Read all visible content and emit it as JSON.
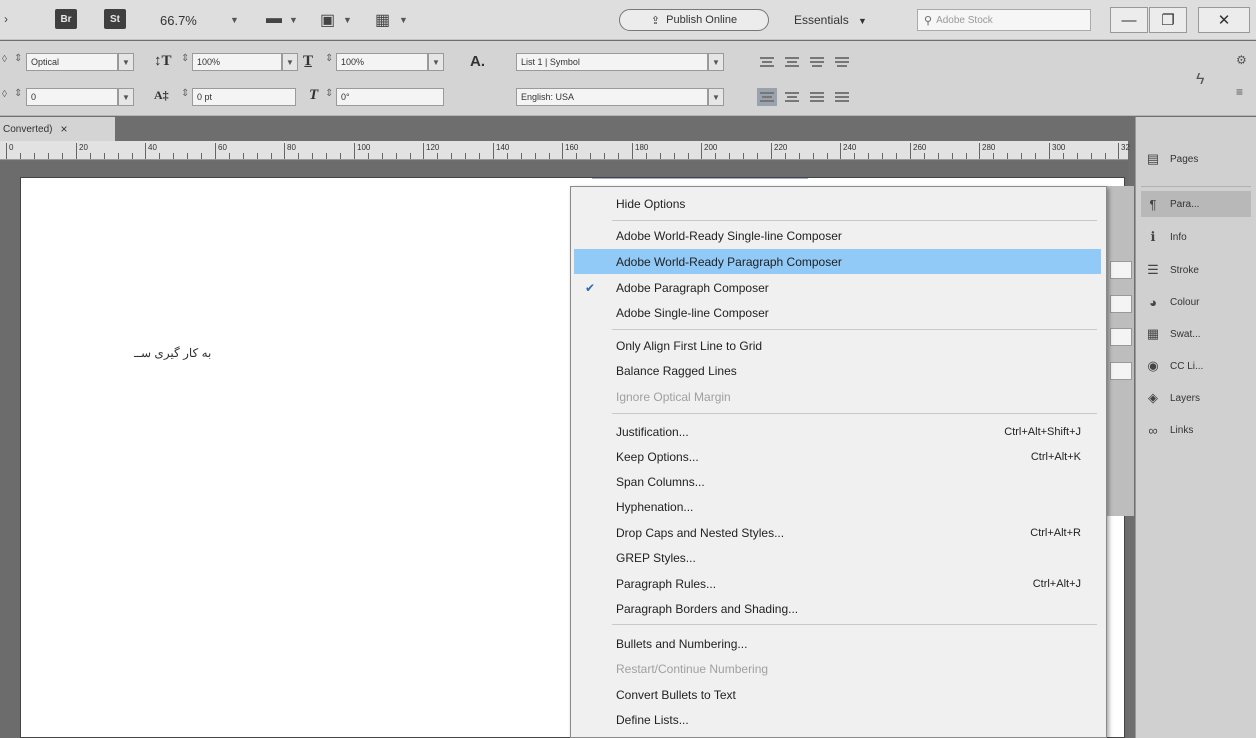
{
  "appbar": {
    "br_badge": "Br",
    "st_badge": "St",
    "zoom": "66.7%",
    "publish_label": "Publish Online",
    "workspace_label": "Essentials",
    "stock_placeholder": "Adobe Stock",
    "window_buttons": [
      "—",
      "❐",
      "✕"
    ]
  },
  "control_bar": {
    "kerning_value": "Optical",
    "tracking_value": "0",
    "vscale_value": "100%",
    "baseline_value": "0 pt",
    "hscale_value": "100%",
    "skew_value": "0°",
    "list_style": "List 1 | Symbol",
    "language": "English: USA"
  },
  "document": {
    "tab_title": "Converted)",
    "tab_close": "×",
    "page_text": "به کار گیری ســ",
    "ruler_labels": [
      "0",
      "20",
      "40",
      "60",
      "80",
      "100",
      "120",
      "140",
      "160",
      "180",
      "200",
      "220",
      "240",
      "260",
      "280",
      "300",
      "32"
    ]
  },
  "dock": {
    "items": [
      {
        "label": "Pages",
        "icon": "pages-icon"
      },
      {
        "label": "Para...",
        "icon": "paragraph-icon"
      },
      {
        "label": "Info",
        "icon": "info-icon"
      },
      {
        "label": "Stroke",
        "icon": "stroke-icon"
      },
      {
        "label": "Colour",
        "icon": "colour-icon"
      },
      {
        "label": "Swat...",
        "icon": "swatches-icon"
      },
      {
        "label": "CC Li...",
        "icon": "cc-libraries-icon"
      },
      {
        "label": "Layers",
        "icon": "layers-icon"
      },
      {
        "label": "Links",
        "icon": "links-icon"
      }
    ]
  },
  "menu": {
    "items": [
      {
        "label": "Hide Options",
        "shortcut": ""
      },
      {
        "label": "Adobe World-Ready Single-line Composer",
        "shortcut": ""
      },
      {
        "label": "Adobe World-Ready Paragraph Composer",
        "shortcut": "",
        "highlighted": true
      },
      {
        "label": "Adobe Paragraph Composer",
        "shortcut": "",
        "checked": true
      },
      {
        "label": "Adobe Single-line Composer",
        "shortcut": ""
      },
      {
        "label": "Only Align First Line to Grid",
        "shortcut": ""
      },
      {
        "label": "Balance Ragged Lines",
        "shortcut": ""
      },
      {
        "label": "Ignore Optical Margin",
        "shortcut": "",
        "disabled": true
      },
      {
        "label": "Justification...",
        "shortcut": "Ctrl+Alt+Shift+J"
      },
      {
        "label": "Keep Options...",
        "shortcut": "Ctrl+Alt+K"
      },
      {
        "label": "Span Columns...",
        "shortcut": ""
      },
      {
        "label": "Hyphenation...",
        "shortcut": ""
      },
      {
        "label": "Drop Caps and Nested Styles...",
        "shortcut": "Ctrl+Alt+R"
      },
      {
        "label": "GREP Styles...",
        "shortcut": ""
      },
      {
        "label": "Paragraph Rules...",
        "shortcut": "Ctrl+Alt+J"
      },
      {
        "label": "Paragraph Borders and Shading...",
        "shortcut": ""
      },
      {
        "label": "Bullets and Numbering...",
        "shortcut": ""
      },
      {
        "label": "Restart/Continue Numbering",
        "shortcut": "",
        "disabled": true
      },
      {
        "label": "Convert Bullets to Text",
        "shortcut": ""
      },
      {
        "label": "Define Lists...",
        "shortcut": ""
      }
    ],
    "check_glyph": "✔"
  },
  "colors": {
    "menu_highlight": "#91c9f7",
    "check": "#2b6cb0"
  }
}
